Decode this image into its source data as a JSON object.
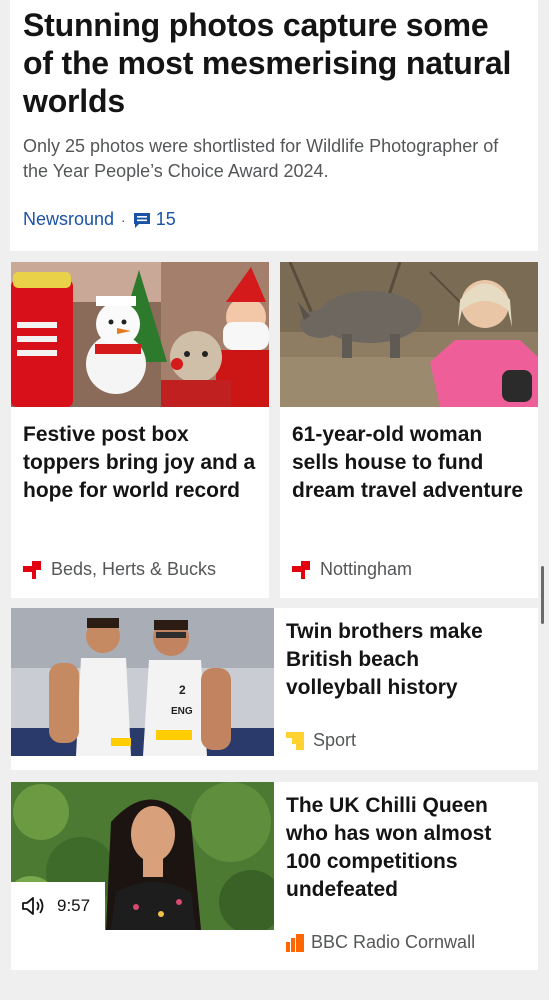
{
  "top_story": {
    "headline": "Stunning photos capture some of the most mesmerising natural worlds",
    "summary": "Only 25 photos were shortlisted for Wildlife Photographer of the Year People’s Choice Award 2024.",
    "source": "Newsround",
    "separator": "·",
    "comment_count": "15"
  },
  "stories": [
    {
      "title": "Festive post box toppers bring joy and a hope for world record",
      "tag": "Beds, Herts & Bucks",
      "tag_icon": "news-region-icon"
    },
    {
      "title": "61-year-old woman sells house to fund dream travel adventure",
      "tag": "Nottingham",
      "tag_icon": "news-region-icon"
    },
    {
      "title": "Twin brothers make British beach volleyball history",
      "tag": "Sport",
      "tag_icon": "sport-icon"
    },
    {
      "title": "The UK Chilli Queen who has won almost 100 competitions undefeated",
      "tag": "BBC Radio Cornwall",
      "tag_icon": "radio-icon",
      "media_duration": "9:57"
    }
  ],
  "colors": {
    "link_blue": "#1a53a6",
    "news_red": "#e3000f",
    "sport_yellow": "#ffd230",
    "radio_orange": "#ff6600"
  }
}
